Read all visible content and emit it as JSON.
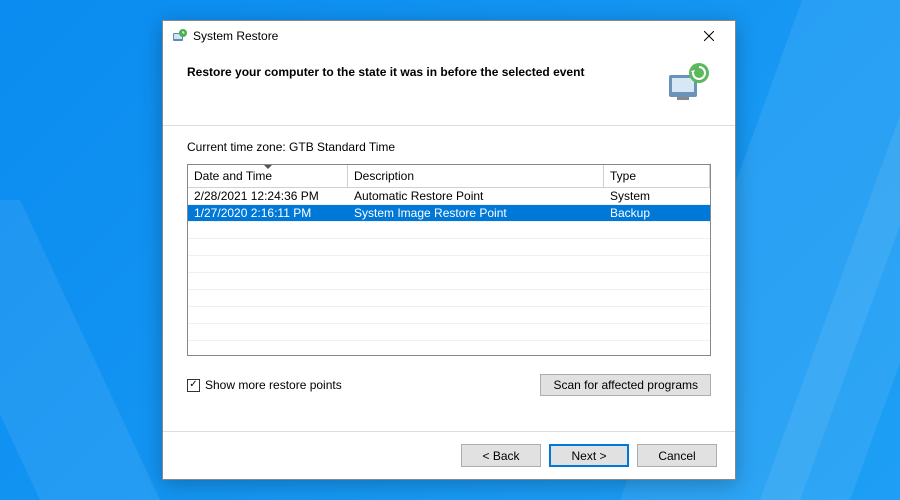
{
  "window": {
    "title": "System Restore"
  },
  "header": {
    "instruction": "Restore your computer to the state it was in before the selected event"
  },
  "content": {
    "timezone_label": "Current time zone: GTB Standard Time",
    "columns": {
      "date": "Date and Time",
      "description": "Description",
      "type": "Type"
    },
    "rows": [
      {
        "date": "2/28/2021 12:24:36 PM",
        "description": "Automatic Restore Point",
        "type": "System",
        "selected": false
      },
      {
        "date": "1/27/2020 2:16:11 PM",
        "description": "System Image Restore Point",
        "type": "Backup",
        "selected": true
      }
    ],
    "show_more_label": "Show more restore points",
    "show_more_checked": true,
    "scan_button": "Scan for affected programs"
  },
  "footer": {
    "back": "< Back",
    "next": "Next >",
    "cancel": "Cancel"
  }
}
